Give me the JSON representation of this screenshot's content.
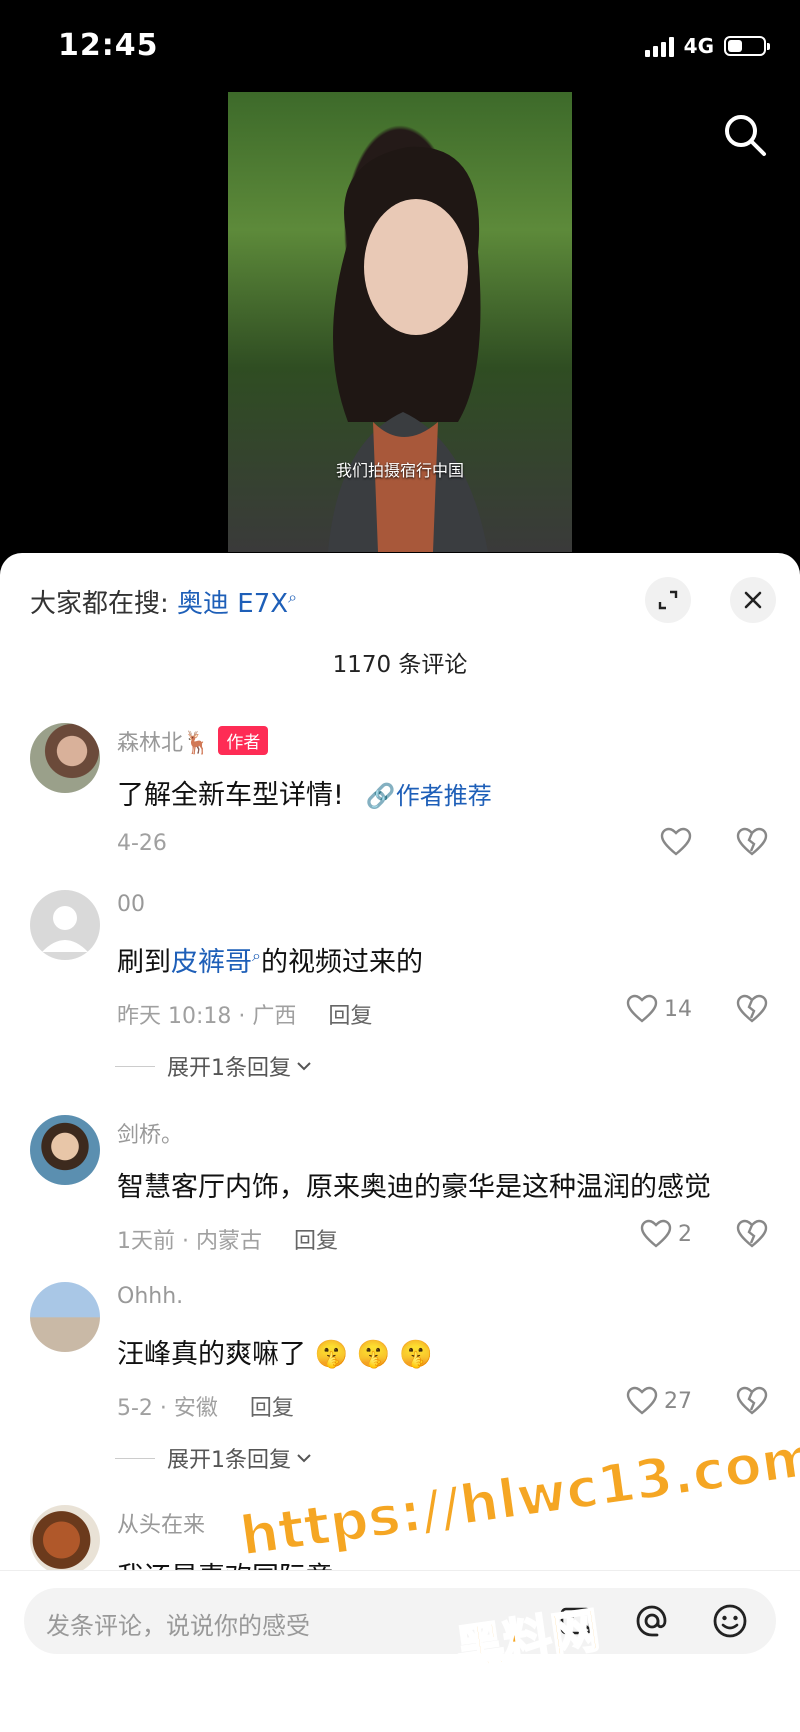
{
  "status": {
    "time": "12:45",
    "network": "4G"
  },
  "video": {
    "caption": "我们拍摄宿行中国"
  },
  "sheet": {
    "hot_search_prefix": "大家都在搜:",
    "hot_search_keyword": "奥迪 E7X",
    "comment_count": "1170 条评论"
  },
  "comments": [
    {
      "name": "森林北🦌",
      "badge": "作者",
      "text": "了解全新车型详情!",
      "recommend": "作者推荐",
      "meta": "4-26"
    },
    {
      "name": "00",
      "text_pre": "刷到",
      "text_link": "皮裤哥",
      "text_post": "的视频过来的",
      "meta": "昨天 10:18 · 广西",
      "reply": "回复",
      "likes": "14",
      "expand": "展开1条回复"
    },
    {
      "name": "剑桥。",
      "text": "智慧客厅内饰，原来奥迪的豪华是这种温润的感觉",
      "meta": "1天前 · 内蒙古",
      "reply": "回复",
      "likes": "2"
    },
    {
      "name": "Ohhh.",
      "text": "汪峰真的爽嘛了 🤫 🤫 🤫",
      "meta": "5-2 · 安徽",
      "reply": "回复",
      "likes": "27",
      "expand": "展开1条回复"
    },
    {
      "name": "从头在来",
      "text": "我还是喜欢国际章"
    }
  ],
  "input": {
    "placeholder": "发条评论，说说你的感受"
  },
  "watermark": {
    "line1": "https://hlwc13.com",
    "line2": "黑料网"
  }
}
